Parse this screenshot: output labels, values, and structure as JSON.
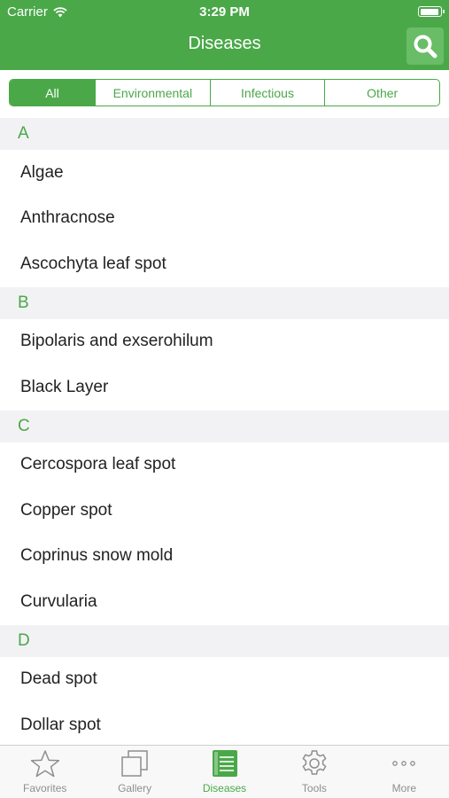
{
  "status": {
    "carrier": "Carrier",
    "time": "3:29 PM"
  },
  "nav": {
    "title": "Diseases"
  },
  "filters": [
    "All",
    "Environmental",
    "Infectious",
    "Other"
  ],
  "sections": [
    {
      "letter": "A",
      "items": [
        "Algae",
        "Anthracnose",
        "Ascochyta leaf spot"
      ]
    },
    {
      "letter": "B",
      "items": [
        "Bipolaris and exserohilum",
        "Black Layer"
      ]
    },
    {
      "letter": "C",
      "items": [
        "Cercospora leaf spot",
        "Copper spot",
        "Coprinus snow mold",
        "Curvularia"
      ]
    },
    {
      "letter": "D",
      "items": [
        "Dead spot",
        "Dollar spot"
      ]
    }
  ],
  "tabs": [
    {
      "label": "Favorites",
      "icon": "star-icon"
    },
    {
      "label": "Gallery",
      "icon": "gallery-icon"
    },
    {
      "label": "Diseases",
      "icon": "list-icon"
    },
    {
      "label": "Tools",
      "icon": "gear-icon"
    },
    {
      "label": "More",
      "icon": "more-icon"
    }
  ],
  "colors": {
    "accent": "#4aa849",
    "section_bg": "#f2f2f4",
    "tab_inactive": "#8e8e8e"
  }
}
